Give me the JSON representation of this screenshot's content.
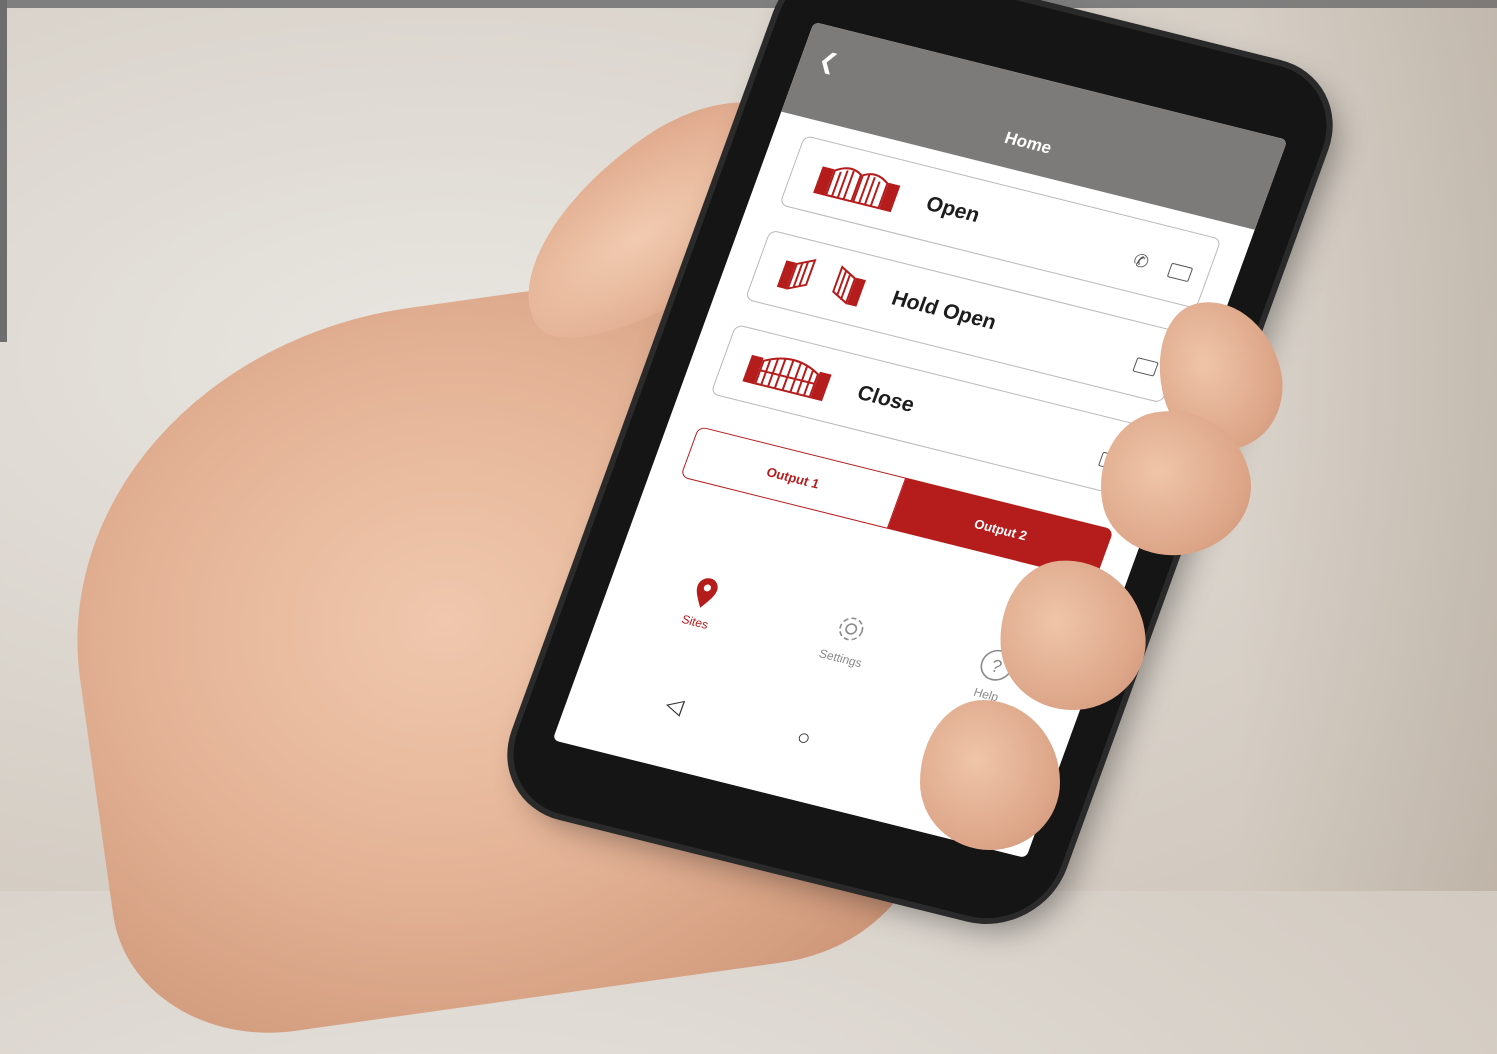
{
  "app": {
    "title": "Home",
    "back_icon": "chevron-left-icon"
  },
  "actions": [
    {
      "label": "Open",
      "icon": "gate-open-icon",
      "has_call": true,
      "has_message": true
    },
    {
      "label": "Hold Open",
      "icon": "gate-hold-open-icon",
      "has_call": false,
      "has_message": true
    },
    {
      "label": "Close",
      "icon": "gate-closed-icon",
      "has_call": false,
      "has_message": true
    }
  ],
  "outputs": {
    "tabs": [
      "Output 1",
      "Output 2"
    ],
    "selected": "Output 2"
  },
  "bottom_nav": {
    "items": [
      {
        "label": "Sites",
        "icon": "location-pin-icon",
        "active": true
      },
      {
        "label": "Settings",
        "icon": "gear-icon",
        "active": false
      },
      {
        "label": "Help",
        "icon": "help-icon",
        "active": false
      }
    ]
  },
  "system_nav": {
    "back": "triangle-back-icon",
    "home": "circle-home-icon",
    "recent": "square-recent-icon"
  },
  "colors": {
    "accent": "#b51c1c",
    "appbar": "#7d7b79",
    "screen_bg": "#ffffff"
  }
}
